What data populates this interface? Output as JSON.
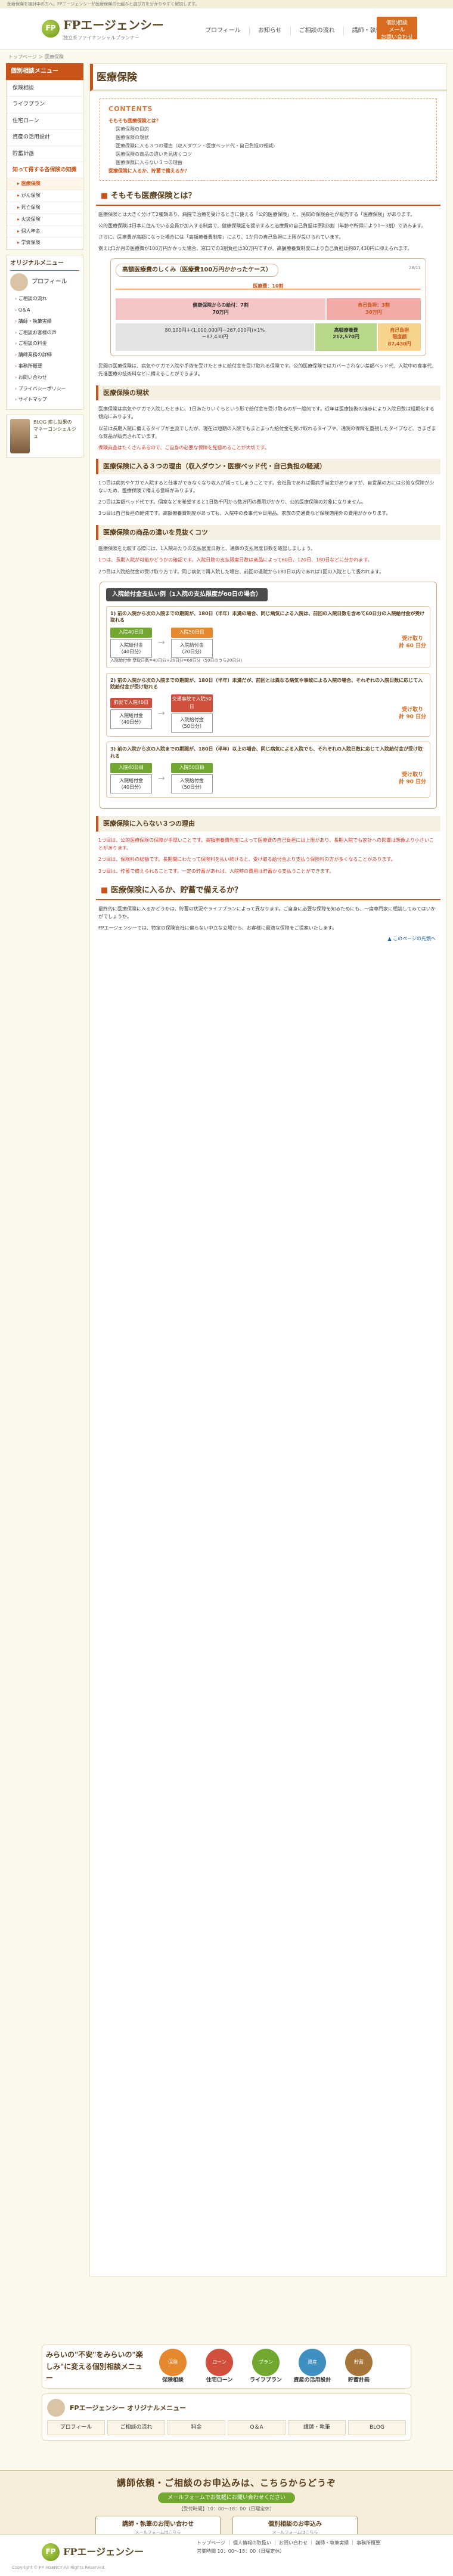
{
  "topbar": {
    "text": "医療保険を検討中の方へ。FPエージェンシーが医療保険の仕組みと選び方を分かりやすく解説します。"
  },
  "header": {
    "logo_text": "FPエージェンシー",
    "logo_sub": "独立系ファイナンシャルプランナー",
    "nav": [
      "プロフィール",
      "お知らせ",
      "ご相談の流れ",
      "講師・執筆実績"
    ],
    "contact": "個別相談\nメール\nお問い合わせ"
  },
  "breadcrumb": "トップページ ＞ 医療保険",
  "sidebar": {
    "head": "個別相談メニュー",
    "items": [
      {
        "label": "保険相談",
        "type": "item"
      },
      {
        "label": "ライフプラン",
        "type": "item"
      },
      {
        "label": "住宅ローン",
        "type": "item"
      },
      {
        "label": "資産の活用設計",
        "type": "item"
      },
      {
        "label": "貯蓄計画",
        "type": "item"
      },
      {
        "label": "知って得する各保険の知識",
        "type": "grp"
      },
      {
        "label": "医療保険",
        "type": "active"
      },
      {
        "label": "がん保険",
        "type": "sub"
      },
      {
        "label": "死亡保険",
        "type": "sub"
      },
      {
        "label": "火災保険",
        "type": "sub"
      },
      {
        "label": "個人年金",
        "type": "sub"
      },
      {
        "label": "学資保険",
        "type": "sub"
      }
    ],
    "orig_title": "オリジナルメニュー",
    "orig_profile": "プロフィール",
    "orig_items": [
      "ご相談の流れ",
      "Q＆A",
      "講師・執筆実績",
      "ご相談お客様の声",
      "ご相談の料金",
      "講師業務の詳細",
      "事務所概要",
      "お問い合わせ",
      "プライバシーポリシー",
      "サイトマップ"
    ],
    "blog": "BLOG 癒し効果の\nマネーコンシェルジュ"
  },
  "main": {
    "title": "医療保険",
    "contents_label": "CONTENTS",
    "contents": [
      {
        "t": "そもそも医療保険とは？",
        "l": 1
      },
      {
        "t": "医療保険の目的",
        "l": 2
      },
      {
        "t": "医療保険の現状",
        "l": 2
      },
      {
        "t": "医療保険に入る３つの理由（収入ダウン・医療ベッド代・自己負担の軽減）",
        "l": 2
      },
      {
        "t": "医療保険の商品の違いを見抜くコツ",
        "l": 2
      },
      {
        "t": "医療保険に入らない３つの理由",
        "l": 2
      },
      {
        "t": "医療保険に入るか、貯蓄で備えるか？",
        "l": 1
      }
    ],
    "s1_title": "そもそも医療保険とは？",
    "s1_p1": "医療保険とは大きく分けて2種類あり、病院で治療を受けるときに使える「公的医療保険」と、民間の保険会社が販売する「医療保険」があります。",
    "s1_p2": "公的医療保険は日本に住んでいる全員が加入する制度で、健康保険証を提示すると治療費の自己負担は原則3割（年齢や所得により1〜3割）で済みます。",
    "s1_p3": "さらに、医療費が高額になった場合には「高額療養費制度」により、1か月の自己負担に上限が設けられています。",
    "s1_p4": "例えば1か月の医療費が100万円かかった場合、窓口での3割負担は30万円ですが、高額療養費制度により自己負担は約87,430円に抑えられます。",
    "chart_title": "高額医療費のしくみ（医療費100万円かかったケース）",
    "chart_src": "28/11",
    "chart_total": "医療費：10割",
    "chart_left": "健康保険からの給付：7割\n70万円",
    "chart_right": "自己負担：3割\n30万円",
    "chart_bottom_left": "80,100円＋(1,000,000円－267,000円)×1%\n＝87,430円",
    "chart_bottom_mid": "高額療養費\n212,570円",
    "chart_bottom_right": "自己負担\n限度額\n87,430円",
    "s1_p5": "民間の医療保険は、病気やケガで入院や手術を受けたときに給付金を受け取れる保険です。公的医療保険ではカバーされない差額ベッド代、入院中の食事代、先進医療の技術料などに備えることができます。",
    "s2_title": "医療保険の現状",
    "s2_p1": "医療保険は病気やケガで入院したときに、1日あたりいくらという形で給付金を受け取るのが一般的です。近年は医療技術の進歩により入院日数は短期化する傾向にあります。",
    "s2_p2": "以前は長期入院に備えるタイプが主流でしたが、現在は短期の入院でもまとまった給付金を受け取れるタイプや、通院の保障を重視したタイプなど、さまざまな商品が販売されています。",
    "s2_p3": "保険商品はたくさんあるので、ご自身の必要な保障を見極めることが大切です。",
    "s3_title": "医療保険に入る３つの理由（収入ダウン・医療ベッド代・自己負担の軽減）",
    "s3_p1": "1つ目は病気やケガで入院すると仕事ができなくなり収入が減ってしまうことです。会社員であれば傷病手当金がありますが、自営業の方には公的な保障が少ないため、医療保険で備える意味があります。",
    "s3_p2": "2つ目は差額ベッド代です。個室などを希望すると1日数千円から数万円の費用がかかり、公的医療保険の対象になりません。",
    "s3_p3": "3つ目は自己負担の軽減です。高額療養費制度があっても、入院中の食事代や日用品、家族の交通費など保険適用外の費用がかかります。",
    "s4_title": "医療保険の商品の違いを見抜くコツ",
    "s4_p1": "医療保険を比較する際には、1入院あたりの支払限度日数と、通算の支払限度日数を確認しましょう。",
    "s4_p2": "1つは、長期入院が可能かどうかの確認です。入院日数の支払限度日数は商品によって60日、120日、180日などに分かれます。",
    "s4_p3": "2つ目は入院給付金の受け取り方です。同じ病気で再入院した場合、前回の退院から180日以内であれば1回の入院として扱われます。",
    "fig_title": "入院給付金支払い例（1入院の支払限度が60日の場合）",
    "ex1_title": "1) 前の入院から次の入院までの期間が、180日（半年）未満の場合、同じ病気による入院は、前回の入院日数を含めて60日分の入院給付金が受け取れる",
    "ex1_a_tag": "入院40日目",
    "ex1_a_amt": "入院給付金\n（40日分）",
    "ex1_b_tag": "入院50日目",
    "ex1_b_amt": "入院給付金\n（20日分）",
    "ex1_paid": "受け取り\n計 60 日分",
    "ex1_note": "入院給付金 受取日数=40日分+20日分=60日分（50日のうち20日分）",
    "ex2_title": "2) 前の入院から次の入院までの期間が、180日（半年）未満だが、前回とは異なる病気や事故による入院の場合、それぞれの入院日数に応じて入院給付金が受け取れる",
    "ex2_a_tag": "肺炎で入院40日",
    "ex2_a_amt": "入院給付金\n（40日分）",
    "ex2_b_tag": "交通事故で入院50日",
    "ex2_b_amt": "入院給付金\n（50日分）",
    "ex2_paid": "受け取り\n計 90 日分",
    "ex3_title": "3) 前の入院から次の入院までの期間が、180日（半年）以上の場合、同じ病気による入院でも、それぞれの入院日数に応じて入院給付金が受け取れる",
    "ex3_a_tag": "入院40日目",
    "ex3_a_amt": "入院給付金\n（40日分）",
    "ex3_b_tag": "入院50日目",
    "ex3_b_amt": "入院給付金\n（50日分）",
    "ex3_paid": "受け取り\n計 90 日分",
    "s5_title": "医療保険に入らない３つの理由",
    "s5_p1": "1つ目は、公的医療保険の保障が手厚いことです。高額療養費制度によって医療費の自己負担には上限があり、長期入院でも家計への影響は想像より小さいことがあります。",
    "s5_p2": "2つ目は、保険料の総額です。長期間にわたって保険料を払い続けると、受け取る給付金より支払う保険料の方が多くなることがあります。",
    "s5_p3": "3つ目は、貯蓄で備えられることです。一定の貯蓄があれば、入院時の費用は貯蓄から支払うことができます。",
    "s6_title": "医療保険に入るか、貯蓄で備えるか？",
    "s6_p1": "最終的に医療保険に入るかどうかは、貯蓄の状況やライフプランによって異なります。ご自身に必要な保障を知るためにも、一度専門家に相談してみてはいかがでしょうか。",
    "s6_p2": "FPエージェンシーでは、特定の保険会社に偏らない中立な立場から、お客様に最適な保障をご提案いたします。",
    "up": "▲ このページの先頭へ"
  },
  "banner": {
    "title": "みらいの\"不安\"をみらいの\"楽しみ\"に変える個別相談メニュー",
    "items": [
      {
        "icon": "保険",
        "label": "保険相談",
        "color": "#e4892e"
      },
      {
        "icon": "ローン",
        "label": "住宅ローン",
        "color": "#d1503d"
      },
      {
        "icon": "プラン",
        "label": "ライフプラン",
        "color": "#72a830"
      },
      {
        "icon": "資産",
        "label": "資産の活用設計",
        "color": "#3f8fc1"
      },
      {
        "icon": "貯蓄",
        "label": "貯蓄計画",
        "color": "#a7743a"
      }
    ]
  },
  "orig_bar": {
    "title": "FPエージェンシー オリジナルメニュー",
    "items": [
      "プロフィール",
      "ご相談の流れ",
      "料金",
      "Q＆A",
      "講師・執筆",
      "BLOG"
    ]
  },
  "contact_band": {
    "title": "講師依頼・ご相談のお申込みは、こちらからどうぞ",
    "sub": "メールフォームでお気軽にお問い合わせください",
    "hours": "【受付時間】10：00〜18：00（日曜定休）",
    "btn1": "講師・執筆のお問い合わせ",
    "btn1_sub": "メールフォームはこちら",
    "btn2": "個別相談のお申込み",
    "btn2_sub": "メールフォームはこちら"
  },
  "footer": {
    "logo": "FPエージェンシー",
    "links": "トップページ ｜ 個人情報の取扱い ｜ お問い合わせ ｜ 講師・執筆実績 ｜ 事務所概要",
    "tel": "営業時間 10：00〜18：00（日曜定休）",
    "copy": "Copyright © FP AGENCY All Rights Reserved."
  }
}
